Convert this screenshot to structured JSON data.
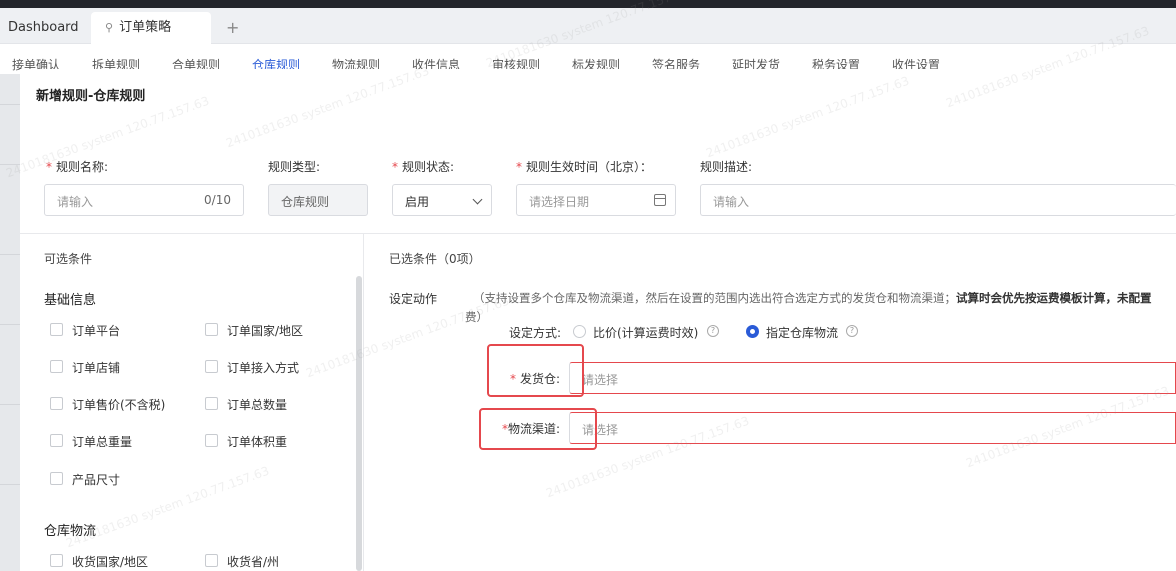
{
  "tabs": {
    "dashboard": "Dashboard",
    "active": "订单策略",
    "add": "+"
  },
  "subnav": [
    "接单确认",
    "拆单规则",
    "合单规则",
    "仓库规则",
    "物流规则",
    "收件信息",
    "审核规则",
    "标发规则",
    "签名服务",
    "延时发货",
    "税务设置",
    "收件设置"
  ],
  "modal": {
    "title": "新增规则-仓库规则",
    "fields": {
      "name": {
        "label": "规则名称:",
        "placeholder": "请输入",
        "counter": "0/10"
      },
      "type": {
        "label": "规则类型:",
        "value": "仓库规则"
      },
      "status": {
        "label": "规则状态:",
        "value": "启用"
      },
      "effective": {
        "label": "规则生效时间（北京）：",
        "placeholder": "请选择日期"
      },
      "desc": {
        "label": "规则描述:",
        "placeholder": "请输入"
      }
    },
    "left": {
      "header": "可选条件",
      "groups": [
        {
          "title": "基础信息",
          "items": [
            "订单平台",
            "订单国家/地区",
            "订单店铺",
            "订单接入方式",
            "订单售价(不含税)",
            "订单总数量",
            "订单总重量",
            "订单体积重",
            "产品尺寸"
          ]
        },
        {
          "title": "仓库物流",
          "items": [
            "收货国家/地区",
            "收货省/州"
          ]
        }
      ]
    },
    "right": {
      "header": "已选条件（0项）",
      "action_label": "设定动作",
      "hint_plain": "（支持设置多个仓库及物流渠道，然后在设置的范围内选出符合选定方式的发货仓和物流渠道；",
      "hint_bold": "试算时会优先按运费模板计算，未配置",
      "hint_tail": "费）",
      "mode_label": "设定方式:",
      "mode_options": [
        "比价(计算运费时效)",
        "指定仓库物流"
      ],
      "mode_selected": "指定仓库物流",
      "warehouse": {
        "label": "发货仓:",
        "placeholder": "请选择"
      },
      "channel": {
        "label": "物流渠道:",
        "placeholder": "请选择"
      }
    }
  },
  "watermark": "2410181630 system 120.77.157.63"
}
